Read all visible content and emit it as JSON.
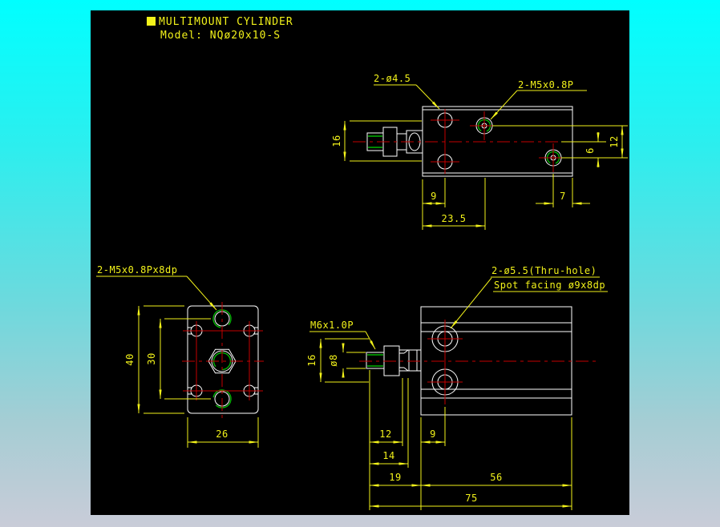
{
  "title": {
    "heading": "MULTIMOUNT CYLINDER",
    "model": "Model: NQø20x10-S"
  },
  "top_view": {
    "label_holes": "2-ø4.5",
    "label_thread": "2-M5x0.8P",
    "dim_16": "16",
    "dim_6": "6",
    "dim_12": "12",
    "dim_9": "9",
    "dim_7": "7",
    "dim_23_5": "23.5"
  },
  "front_view": {
    "label_thread": "2-M5x0.8Px8dp",
    "dim_40": "40",
    "dim_30": "30",
    "dim_26": "26"
  },
  "side_view": {
    "label_thru_hole": "2-ø5.5(Thru-hole)",
    "label_spot_facing": "Spot facing ø9x8dp",
    "label_rod_thread": "M6x1.0P",
    "dim_16": "16",
    "dim_rod_dia": "ø8",
    "dim_12": "12",
    "dim_14": "14",
    "dim_9": "9",
    "dim_19": "19",
    "dim_56": "56",
    "dim_75": "75"
  },
  "colors": {
    "background_top": "#00ffff",
    "background_bottom": "#c9ccd8",
    "canvas": "#000000",
    "geometry": "#ffffff",
    "dimension": "#f2f21a",
    "centerline": "#c40000",
    "thread": "#00b400"
  }
}
